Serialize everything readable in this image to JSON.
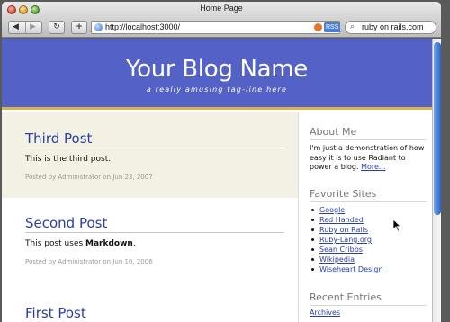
{
  "window": {
    "title": "Home Page"
  },
  "toolbar": {
    "url": "http://localhost:3000/",
    "rss_label": "RSS",
    "search_value": "ruby on rails.com"
  },
  "blog": {
    "name": "Your Blog Name",
    "tagline": "a really amusing tag-line here"
  },
  "posts": [
    {
      "title": "Third Post",
      "body": "This is the third post.",
      "meta": "Posted by Administrator on Jun 23, 2007"
    },
    {
      "title": "Second Post",
      "body_prefix": "This post uses ",
      "body_bold": "Markdown",
      "body_suffix": ".",
      "meta": "Posted by Administrator on Jun 10, 2006"
    },
    {
      "title": "First Post"
    }
  ],
  "sidebar": {
    "about_heading": "About Me",
    "about_text": "I'm just a demonstration of how easy it is to use Radiant to power a blog.",
    "about_more": "More...",
    "favorites_heading": "Favorite Sites",
    "favorites": [
      "Google",
      "Red Handed",
      "Ruby on Rails",
      "Ruby-Lang.org",
      "Sean Cribbs",
      "Wikipedia",
      "Wiseheart Design"
    ],
    "recent_heading": "Recent Entries",
    "recent_first": "Archives"
  }
}
